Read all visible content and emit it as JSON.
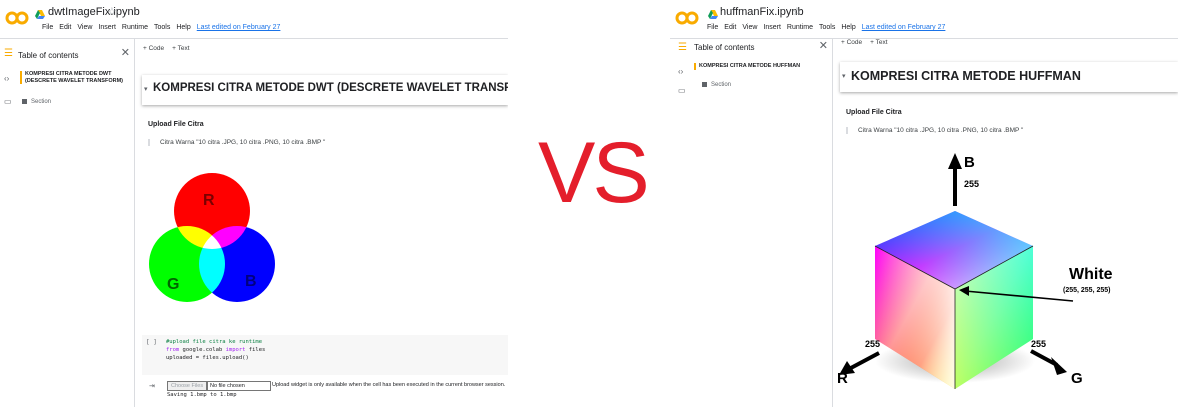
{
  "vs_label": "VS",
  "menu": [
    "File",
    "Edit",
    "View",
    "Insert",
    "Runtime",
    "Tools",
    "Help"
  ],
  "left": {
    "notebook_title": "dwtImageFix.ipynb",
    "last_edited": "Last edited on February 27",
    "toc_title": "Table of contents",
    "toc_entry": "KOMPRESI CITRA METODE DWT (DESCRETE WAVELET TRANSFORM)",
    "toc_section": "Section",
    "add_code": "+ Code",
    "add_text": "+ Text",
    "heading": "KOMPRESI CITRA METODE DWT (DESCRETE WAVELET TRANSFORM)",
    "upload_title": "Upload File Citra",
    "quote": "Citra Warna \"10 citra .JPG, 10 citra .PNG, 10 citra .BMP \"",
    "venn_labels": {
      "r": "R",
      "g": "G",
      "b": "B"
    },
    "code_bracket": "[ ]",
    "code_comment": "#upload file citra ke runtime",
    "code_line2_kw1": "from",
    "code_line2_mid": " google.colab ",
    "code_line2_kw2": "import",
    "code_line2_end": " files",
    "code_line3": "uploaded = files.upload()",
    "choose_files": "Choose Files",
    "no_file": "No file chosen",
    "widget_note": "Upload widget is only available when the cell has been executed in the current browser session.",
    "saving": "Saving 1.bmp to 1.bmp"
  },
  "right": {
    "notebook_title": "huffmanFix.ipynb",
    "last_edited": "Last edited on February 27",
    "toc_title": "Table of contents",
    "toc_entry": "KOMPRESI CITRA METODE HUFFMAN",
    "toc_section": "Section",
    "add_code": "+ Code",
    "add_text": "+ Text",
    "heading": "KOMPRESI CITRA METODE HUFFMAN",
    "upload_title": "Upload File Citra",
    "quote": "Citra Warna \"10 citra .JPG, 10 citra .PNG, 10 citra .BMP \"",
    "cube": {
      "b_label": "B",
      "b_value": "255",
      "r_label": "R",
      "r_value": "255",
      "g_label": "G",
      "g_value": "255",
      "white_label": "White",
      "white_value": "(255, 255, 255)"
    }
  },
  "colors": {
    "vs": "#e41e2b",
    "toc_accent": "#f9ab00",
    "link": "#1a73e8"
  }
}
